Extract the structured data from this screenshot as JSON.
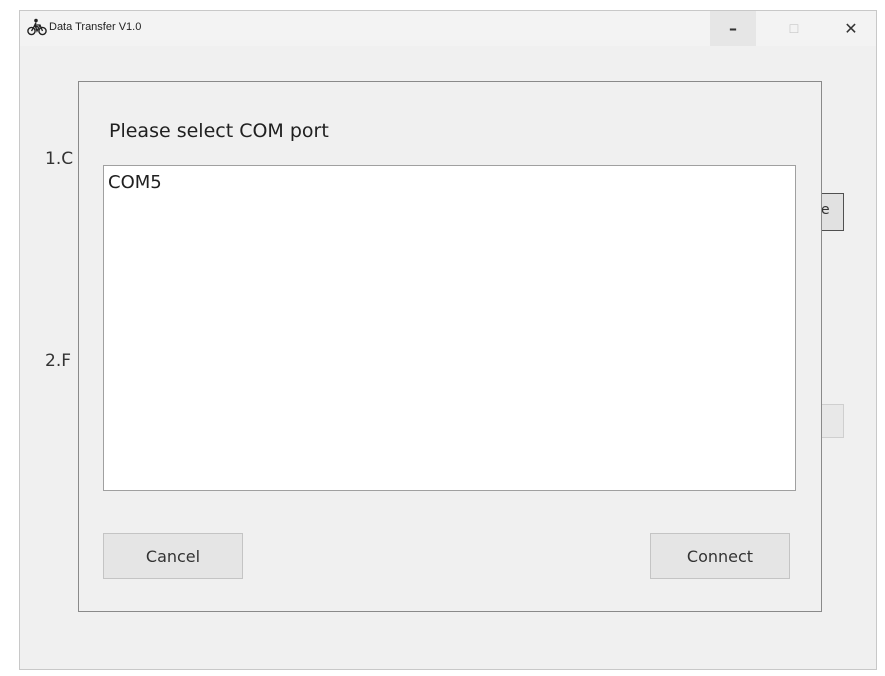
{
  "window": {
    "title": "Data Transfer V1.0",
    "controls": {
      "minimize": "–",
      "maximize": "☐",
      "close": "✕"
    }
  },
  "background": {
    "step1_label": "1.C",
    "step2_label": "2.F",
    "step1_button_fragment": "e"
  },
  "dialog": {
    "title": "Please select COM port",
    "ports": [
      "COM5"
    ],
    "cancel_label": "Cancel",
    "connect_label": "Connect"
  }
}
